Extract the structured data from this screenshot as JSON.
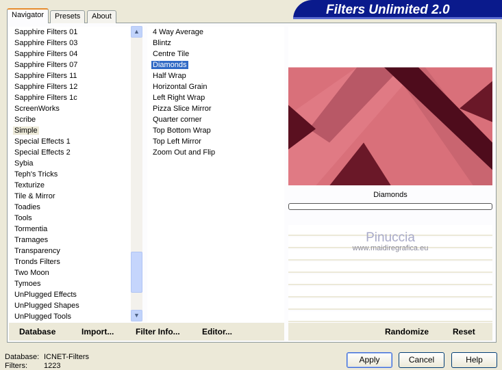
{
  "window": {
    "title": "Filters Unlimited 2.0"
  },
  "tabs": [
    {
      "label": "Navigator",
      "active": true
    },
    {
      "label": "Presets",
      "active": false
    },
    {
      "label": "About",
      "active": false
    }
  ],
  "categories": {
    "selected": "Simple",
    "items": [
      "Sapphire Filters 01",
      "Sapphire Filters 03",
      "Sapphire Filters 04",
      "Sapphire Filters 07",
      "Sapphire Filters 11",
      "Sapphire Filters 12",
      "Sapphire Filters 1c",
      "ScreenWorks",
      "Scribe",
      "Simple",
      "Special Effects 1",
      "Special Effects 2",
      "Sybia",
      "Teph's Tricks",
      "Texturize",
      "Tile & Mirror",
      "Toadies",
      "Tools",
      "Tormentia",
      "Tramages",
      "Transparency",
      "Tronds Filters",
      "Two Moon",
      "Tymoes",
      "UnPlugged Effects",
      "UnPlugged Shapes",
      "UnPlugged Tools"
    ]
  },
  "filters": {
    "selected": "Diamonds",
    "items": [
      "4 Way Average",
      "Blintz",
      "Centre Tile",
      "Diamonds",
      "Half Wrap",
      "Horizontal Grain",
      "Left Right Wrap",
      "Pizza Slice Mirror",
      "Quarter corner",
      "Top Bottom Wrap",
      "Top Left Mirror",
      "Zoom Out and Flip"
    ]
  },
  "preview": {
    "filter_name": "Diamonds",
    "progress": 0,
    "colors": {
      "base": "#d9707a",
      "dark": "#5a1020"
    }
  },
  "watermark": {
    "name": "Pinuccia",
    "url": "www.maidiregrafica.eu"
  },
  "toolbar": {
    "database": "Database",
    "import": "Import...",
    "filter_info": "Filter Info...",
    "editor": "Editor...",
    "randomize": "Randomize",
    "reset": "Reset"
  },
  "status": {
    "database_label": "Database:",
    "database_value": "ICNET-Filters",
    "filters_label": "Filters:",
    "filters_value": "1223"
  },
  "buttons": {
    "apply": "Apply",
    "cancel": "Cancel",
    "help": "Help"
  }
}
